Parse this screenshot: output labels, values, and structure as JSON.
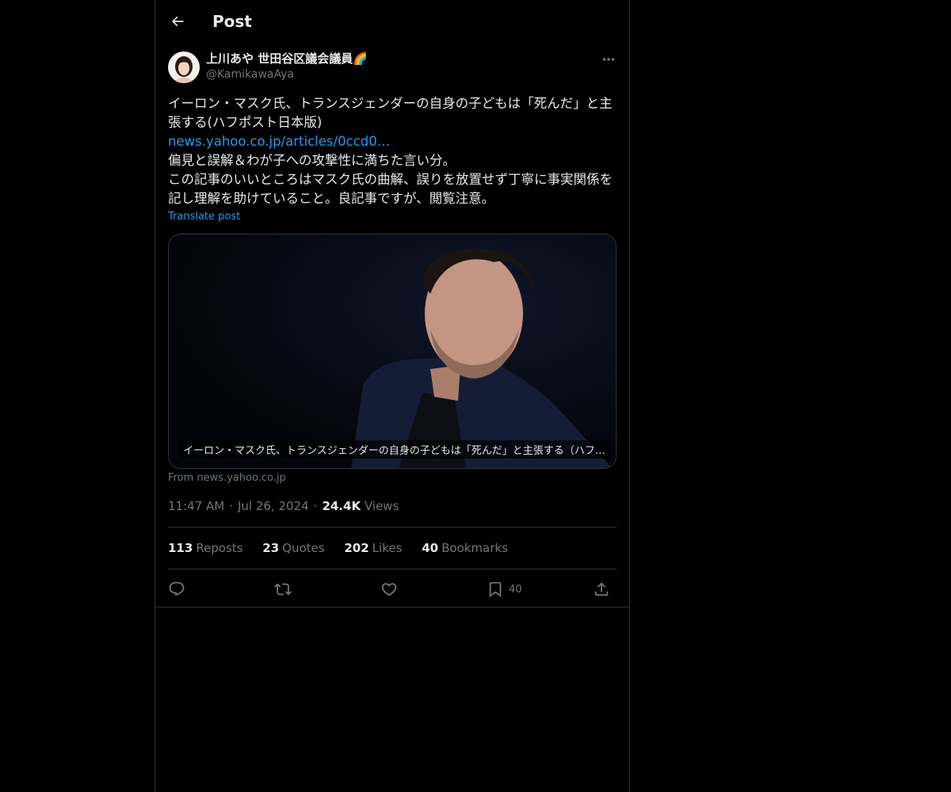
{
  "header": {
    "title": "Post"
  },
  "author": {
    "display_name": "上川あや 世田谷区議会議員🌈",
    "handle": "@KamikawaAya"
  },
  "post": {
    "line1": "イーロン・マスク氏、トランスジェンダーの自身の子どもは「死んだ」と主張する(ハフポスト日本版)",
    "link": "news.yahoo.co.jp/articles/0ccd0…",
    "line3": "偏見と誤解＆わが子への攻撃性に満ちた言い分。",
    "line4": "この記事のいいところはマスク氏の曲解、誤りを放置せず丁寧に事実関係を記し理解を助けていること。良記事ですが、閲覧注意。",
    "translate_label": "Translate post"
  },
  "card": {
    "caption": "イーロン・マスク氏、トランスジェンダーの自身の子どもは「死んだ」と主張する（ハフ…",
    "source_prefix": "From ",
    "source_domain": "news.yahoo.co.jp"
  },
  "meta": {
    "time": "11:47 AM",
    "date": "Jul 26, 2024",
    "views_count": "24.4K",
    "views_label": "Views"
  },
  "stats": {
    "reposts_count": "113",
    "reposts_label": "Reposts",
    "quotes_count": "23",
    "quotes_label": "Quotes",
    "likes_count": "202",
    "likes_label": "Likes",
    "bookmarks_count": "40",
    "bookmarks_label": "Bookmarks"
  },
  "actions": {
    "bookmark_count": "40"
  },
  "icons": [
    "back-arrow-icon",
    "more-icon",
    "reply-icon",
    "repost-icon",
    "like-icon",
    "bookmark-icon",
    "share-icon"
  ],
  "colors": {
    "background": "#000000",
    "text": "#e7e9ea",
    "muted": "#71767b",
    "link": "#1d9bf0",
    "border": "#2f3336"
  }
}
